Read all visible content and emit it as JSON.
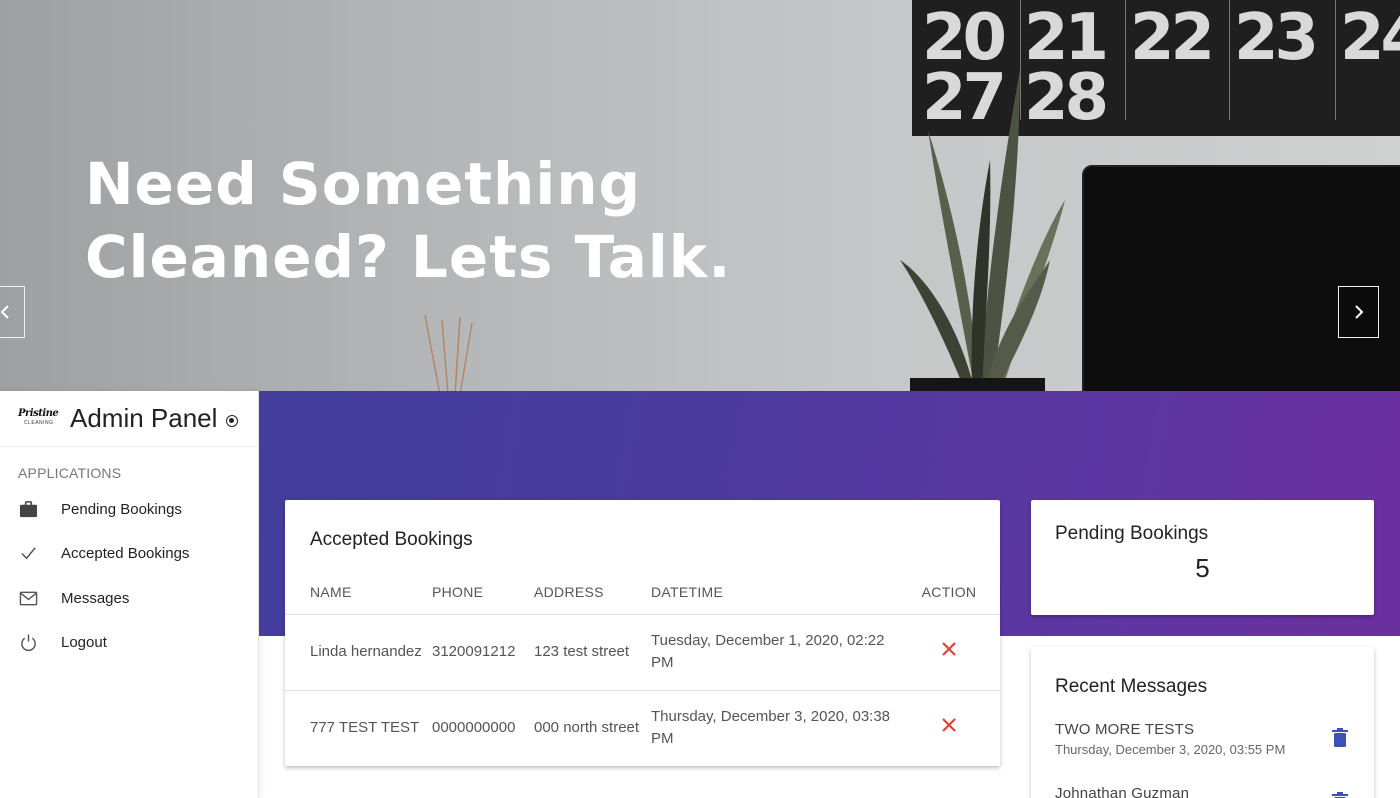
{
  "hero": {
    "title_line1": "Need Something",
    "title_line2": "Cleaned? Lets Talk.",
    "calendar_numbers": [
      "20",
      "21",
      "22",
      "23",
      "24",
      "27",
      "28"
    ]
  },
  "sidebar": {
    "logo_text": "Pristine",
    "logo_subtext": "CLEANING",
    "title": "Admin Panel",
    "section_label": "APPLICATIONS",
    "items": [
      {
        "label": "Pending Bookings",
        "icon": "briefcase-icon"
      },
      {
        "label": "Accepted Bookings",
        "icon": "check-icon"
      },
      {
        "label": "Messages",
        "icon": "mail-icon"
      },
      {
        "label": "Logout",
        "icon": "power-icon"
      }
    ]
  },
  "accepted_bookings": {
    "title": "Accepted Bookings",
    "columns": [
      "NAME",
      "PHONE",
      "ADDRESS",
      "DATETIME",
      "ACTION"
    ],
    "rows": [
      {
        "name": "Linda hernandez",
        "phone": "3120091212",
        "address": "123 test street",
        "datetime": "Tuesday, December 1, 2020, 02:22 PM"
      },
      {
        "name": "777 TEST TEST",
        "phone": "0000000000",
        "address": "000 north street",
        "datetime": "Thursday, December 3, 2020, 03:38 PM"
      }
    ]
  },
  "pending_bookings": {
    "title": "Pending Bookings",
    "count": "5"
  },
  "recent_messages": {
    "title": "Recent Messages",
    "items": [
      {
        "title": "TWO MORE TESTS",
        "date": "Thursday, December 3, 2020, 03:55 PM"
      },
      {
        "title": "Johnathan Guzman",
        "date": ""
      }
    ]
  },
  "colors": {
    "accent_blue": "#3f51b5",
    "delete_red": "#e53935",
    "header_gradient_start": "#433d9c",
    "header_gradient_end": "#6c2f9f"
  }
}
